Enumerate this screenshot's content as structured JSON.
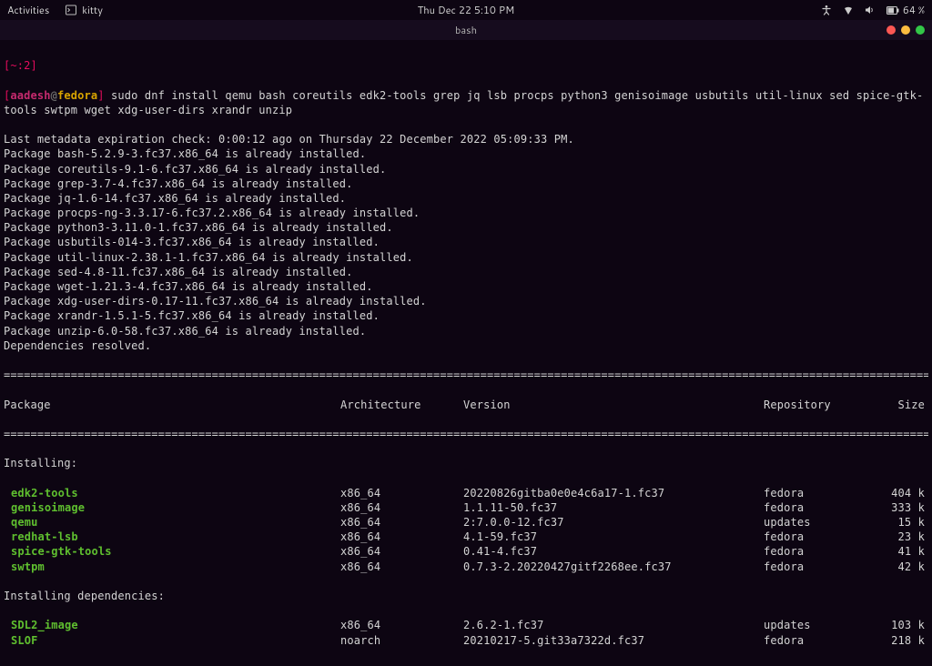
{
  "topbar": {
    "activities": "Activities",
    "app_name": "kitty",
    "datetime": "Thu Dec 22   5:10 PM",
    "battery": "64 %"
  },
  "window": {
    "title": "bash"
  },
  "ps1": {
    "prefix": "[~:2]",
    "open": "[",
    "user": "aadesh",
    "at": "@",
    "host": "fedora",
    "close": "]"
  },
  "command": " sudo dnf install qemu bash coreutils edk2-tools grep jq lsb procps python3 genisoimage usbutils util-linux sed spice-gtk-tools swtpm wget xdg-user-dirs xrandr unzip",
  "output_lines": [
    "Last metadata expiration check: 0:00:12 ago on Thursday 22 December 2022 05:09:33 PM.",
    "Package bash-5.2.9-3.fc37.x86_64 is already installed.",
    "Package coreutils-9.1-6.fc37.x86_64 is already installed.",
    "Package grep-3.7-4.fc37.x86_64 is already installed.",
    "Package jq-1.6-14.fc37.x86_64 is already installed.",
    "Package procps-ng-3.3.17-6.fc37.2.x86_64 is already installed.",
    "Package python3-3.11.0-1.fc37.x86_64 is already installed.",
    "Package usbutils-014-3.fc37.x86_64 is already installed.",
    "Package util-linux-2.38.1-1.fc37.x86_64 is already installed.",
    "Package sed-4.8-11.fc37.x86_64 is already installed.",
    "Package wget-1.21.3-4.fc37.x86_64 is already installed.",
    "Package xdg-user-dirs-0.17-11.fc37.x86_64 is already installed.",
    "Package xrandr-1.5.1-5.fc37.x86_64 is already installed.",
    "Package unzip-6.0-58.fc37.x86_64 is already installed.",
    "Dependencies resolved."
  ],
  "divider": "========================================================================================================================================================",
  "headers": {
    "pkg": "Package",
    "arch": "Architecture",
    "ver": "Version",
    "repo": "Repository",
    "size": "Size"
  },
  "sections": {
    "installing": "Installing:",
    "installing_deps": "Installing dependencies:"
  },
  "installing": [
    {
      "name": "edk2-tools",
      "arch": "x86_64",
      "ver": "20220826gitba0e0e4c6a17-1.fc37",
      "repo": "fedora",
      "size": "404 k"
    },
    {
      "name": "genisoimage",
      "arch": "x86_64",
      "ver": "1.1.11-50.fc37",
      "repo": "fedora",
      "size": "333 k"
    },
    {
      "name": "qemu",
      "arch": "x86_64",
      "ver": "2:7.0.0-12.fc37",
      "repo": "updates",
      "size": "15 k"
    },
    {
      "name": "redhat-lsb",
      "arch": "x86_64",
      "ver": "4.1-59.fc37",
      "repo": "fedora",
      "size": "23 k"
    },
    {
      "name": "spice-gtk-tools",
      "arch": "x86_64",
      "ver": "0.41-4.fc37",
      "repo": "fedora",
      "size": "41 k"
    },
    {
      "name": "swtpm",
      "arch": "x86_64",
      "ver": "0.7.3-2.20220427gitf2268ee.fc37",
      "repo": "fedora",
      "size": "42 k"
    }
  ],
  "installing_deps": [
    {
      "name": "SDL2_image",
      "arch": "x86_64",
      "ver": "2.6.2-1.fc37",
      "repo": "updates",
      "size": "103 k"
    },
    {
      "name": "SLOF",
      "arch": "noarch",
      "ver": "20210217-5.git33a7322d.fc37",
      "repo": "fedora",
      "size": "218 k"
    }
  ]
}
